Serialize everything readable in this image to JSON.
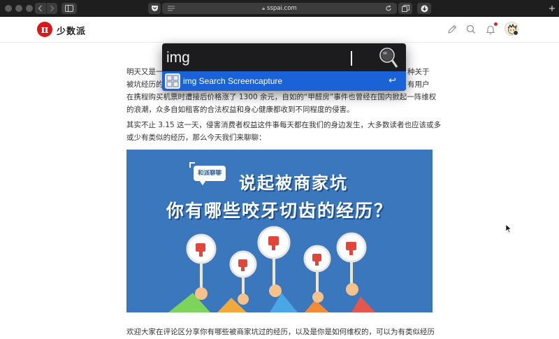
{
  "browser": {
    "url": "sspai.com",
    "icons": [
      "back-icon",
      "forward-icon",
      "sidebar-icon",
      "pocket-icon",
      "menu-icon",
      "reload-icon",
      "tabs-icon",
      "download-icon"
    ]
  },
  "site": {
    "logo_glyph": "π",
    "logo_text": "少数派",
    "brand_color": "#d7191a",
    "icons": [
      "edit-icon",
      "search-icon",
      "bell-icon",
      "avatar"
    ]
  },
  "article": {
    "para1": [
      "明天又是一",
      "被坑经历的",
      "在携程购买机票时遭接后价格涨了 1300 余元，自如的“甲醛房”事件也曾经在国内掀起一阵维权",
      "的浪潮，众多自如租客的合法权益和身心健康都收到不同程度的侵害。"
    ],
    "para1_right": [
      "种关于",
      "有用户"
    ],
    "para2": [
      "其实不止 3.15 这一天，侵害消费者权益这件事每天都在我们的身边发生，大多数读者也应该或多",
      "或少有类似的经历，那么今天我们来聊聊："
    ],
    "banner": {
      "bubble": "和派聊聊",
      "title1": "说起被商家坑",
      "title2": "你有哪些咬牙切齿的经历？",
      "bg_color": "#3a77bd"
    },
    "para3": "欢迎大家在评论区分享你有哪些被商家坑过的经历，以及是你是如何维权的，可以为有类似经历"
  },
  "launcher": {
    "query": "img",
    "result_label": "img Search Screencapture",
    "result_enter": "↩",
    "highlight_color": "#1a62d6"
  }
}
